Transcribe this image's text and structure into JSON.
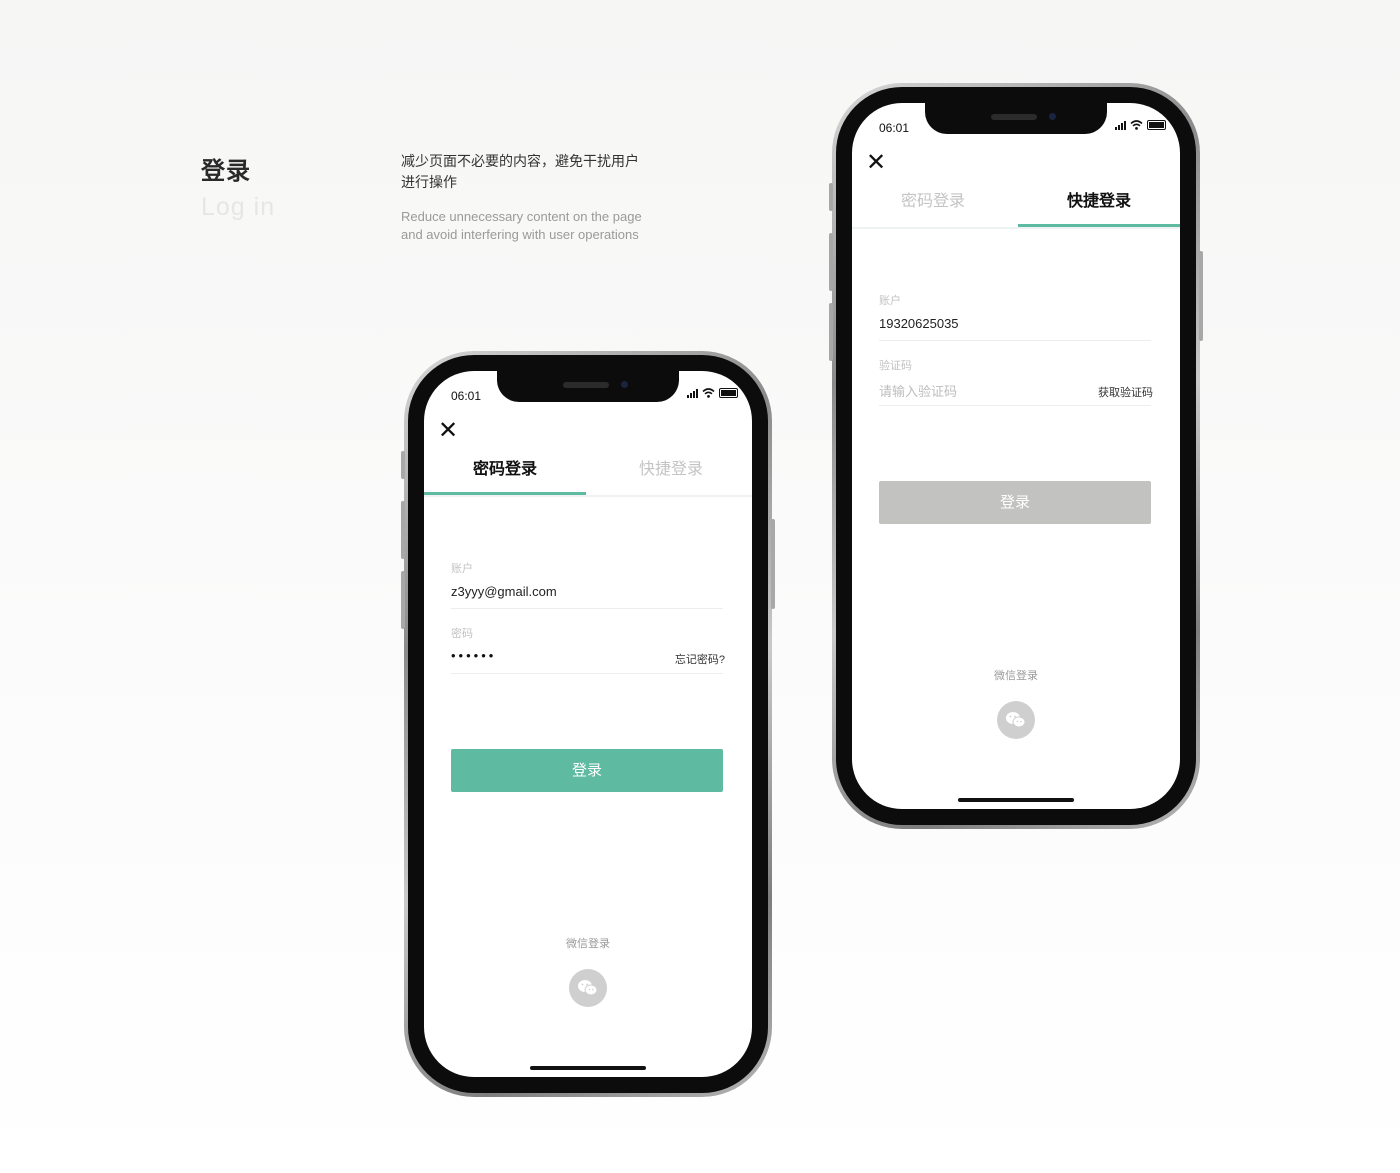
{
  "header": {
    "title_cn": "登录",
    "title_en": "Log in",
    "desc_cn": "减少页面不必要的内容，避免干扰用户进行操作",
    "desc_en": "Reduce unnecessary content on the page and avoid interfering with user operations"
  },
  "colors": {
    "accent": "#5fbaa2",
    "disabled_button": "#c2c2c0",
    "icon_circle": "#cfcfcf"
  },
  "status_bar": {
    "time": "06:01"
  },
  "tabs": {
    "password": "密码登录",
    "quick": "快捷登录"
  },
  "password_screen": {
    "account_label": "账户",
    "account_value": "z3yyy@gmail.com",
    "password_label": "密码",
    "password_value": "••••••",
    "forgot_link": "忘记密码?",
    "login_button": "登录",
    "wechat_label": "微信登录"
  },
  "quick_screen": {
    "account_label": "账户",
    "account_value": "19320625035",
    "code_label": "验证码",
    "code_placeholder": "请输入验证码",
    "get_code_link": "获取验证码",
    "login_button": "登录",
    "wechat_label": "微信登录"
  }
}
